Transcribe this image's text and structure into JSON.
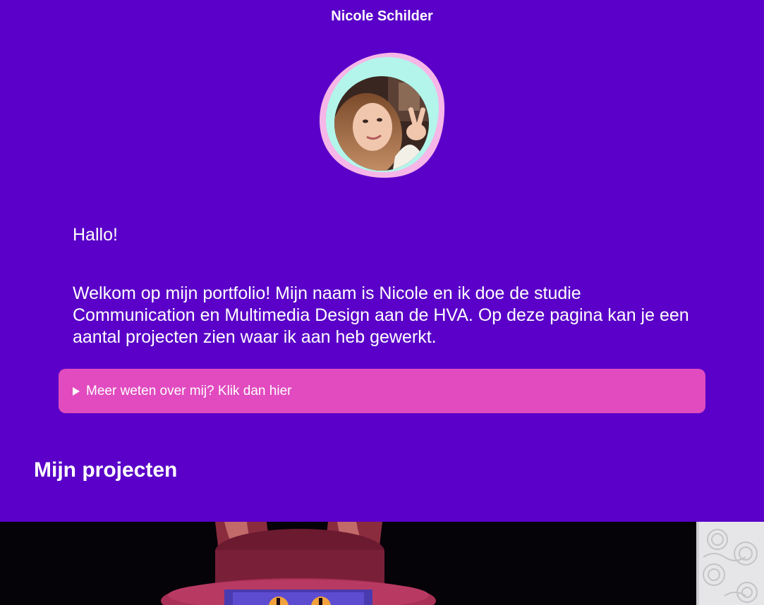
{
  "header": {
    "title": "Nicole Schilder"
  },
  "profile": {
    "avatar_icon": "profile-photo"
  },
  "intro": {
    "greeting": "Hallo!",
    "text": "Welkom op mijn portfolio! Mijn naam is Nicole en ik doe de studie Communication en Multimedia Design aan de HVA. Op deze pagina kan je een aantal projecten zien waar ik aan heb gewerkt."
  },
  "more_info": {
    "summary": "Meer weten over mij? Klik dan hier",
    "state": "collapsed"
  },
  "projects": {
    "heading": "Mijn projecten",
    "items": [
      {
        "name": "project-cat-character"
      },
      {
        "name": "project-pattern"
      }
    ]
  },
  "colors": {
    "background": "#5a00c8",
    "accent_pink": "#e14bbf",
    "blob_pink": "#f6b6e8",
    "blob_mint": "#b3f5ea"
  }
}
